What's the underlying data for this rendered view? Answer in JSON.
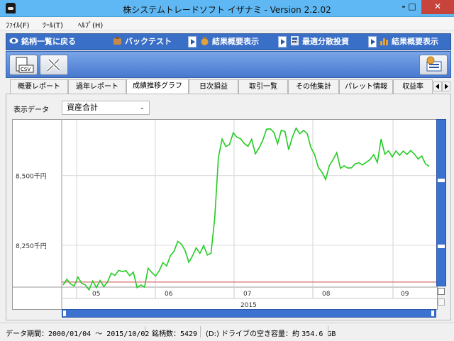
{
  "window": {
    "title": "株システムトレードソフト イザナミ - Version 2.2.02",
    "minimize": "-",
    "maximize": "□",
    "close": "✕"
  },
  "menu": [
    "ﾌｧｲﾙ(F)",
    "ﾂｰﾙ(T)",
    "ﾍﾙﾌﾟ(H)"
  ],
  "nav": [
    {
      "label": "銘柄一覧に戻る",
      "icon": "eye-icon"
    },
    {
      "label": "バックテスト",
      "icon": "bag-icon"
    },
    {
      "label": "結果概要表示",
      "icon": "money-bag-icon"
    },
    {
      "label": "最適分散投資",
      "icon": "calculator-icon"
    },
    {
      "label": "結果概要表示",
      "icon": "bar-chart-icon"
    }
  ],
  "toolbar": {
    "csv_label": "CSV"
  },
  "subtabs": [
    "概要レポート",
    "過年レポート",
    "成績推移グラフ",
    "日次損益",
    "取引一覧",
    "その他集計",
    "パレット情報",
    "収益率"
  ],
  "active_subtab": 2,
  "panel": {
    "data_label": "表示データ",
    "data_select": "資産合計"
  },
  "chart_data": {
    "type": "line",
    "ylabels": [
      "8,500千円",
      "8,250千円"
    ],
    "yticks": [
      8500,
      8250
    ],
    "ylim": [
      8100,
      8700
    ],
    "xticks": [
      "05",
      "06",
      "07",
      "08",
      "09"
    ],
    "year_label": "2015",
    "baseline": 8118,
    "series": [
      {
        "color": "#22cc22",
        "x": [
          0,
          1,
          2,
          3,
          4,
          5,
          6,
          7,
          8,
          9,
          10,
          11,
          12,
          13,
          14,
          15,
          16,
          17,
          18,
          19,
          20,
          21,
          22,
          23,
          24,
          25,
          26,
          27,
          28,
          29,
          30,
          31,
          32,
          33,
          34,
          35,
          36,
          37,
          38,
          39,
          40,
          41,
          42,
          43,
          44,
          45,
          46,
          47,
          48,
          49,
          50,
          51,
          52,
          53,
          54,
          55,
          56,
          57,
          58,
          59,
          60,
          61,
          62,
          63,
          64,
          65,
          66,
          67,
          68,
          69,
          70,
          71,
          72,
          73,
          74,
          75,
          76,
          77,
          78,
          79,
          80,
          81,
          82,
          83,
          84,
          85,
          86,
          87,
          88,
          89,
          90,
          91,
          92,
          93,
          94,
          95,
          96,
          97,
          98,
          99
        ],
        "values": [
          8108,
          8128,
          8112,
          8104,
          8136,
          8114,
          8108,
          8090,
          8122,
          8098,
          8124,
          8102,
          8118,
          8150,
          8142,
          8160,
          8156,
          8159,
          8141,
          8154,
          8098,
          8108,
          8100,
          8168,
          8152,
          8140,
          8159,
          8188,
          8176,
          8213,
          8229,
          8264,
          8254,
          8231,
          8189,
          8212,
          8241,
          8221,
          8249,
          8215,
          8222,
          8347,
          8565,
          8631,
          8604,
          8611,
          8653,
          8638,
          8632,
          8615,
          8605,
          8630,
          8578,
          8599,
          8627,
          8666,
          8668,
          8655,
          8614,
          8662,
          8658,
          8593,
          8638,
          8670,
          8650,
          8662,
          8651,
          8601,
          8576,
          8530,
          8513,
          8486,
          8536,
          8557,
          8582,
          8526,
          8535,
          8527,
          8528,
          8542,
          8546,
          8538,
          8548,
          8557,
          8575,
          8547,
          8631,
          8577,
          8589,
          8567,
          8588,
          8573,
          8588,
          8576,
          8590,
          8577,
          8560,
          8570,
          8542,
          8533
        ]
      }
    ]
  }
}
